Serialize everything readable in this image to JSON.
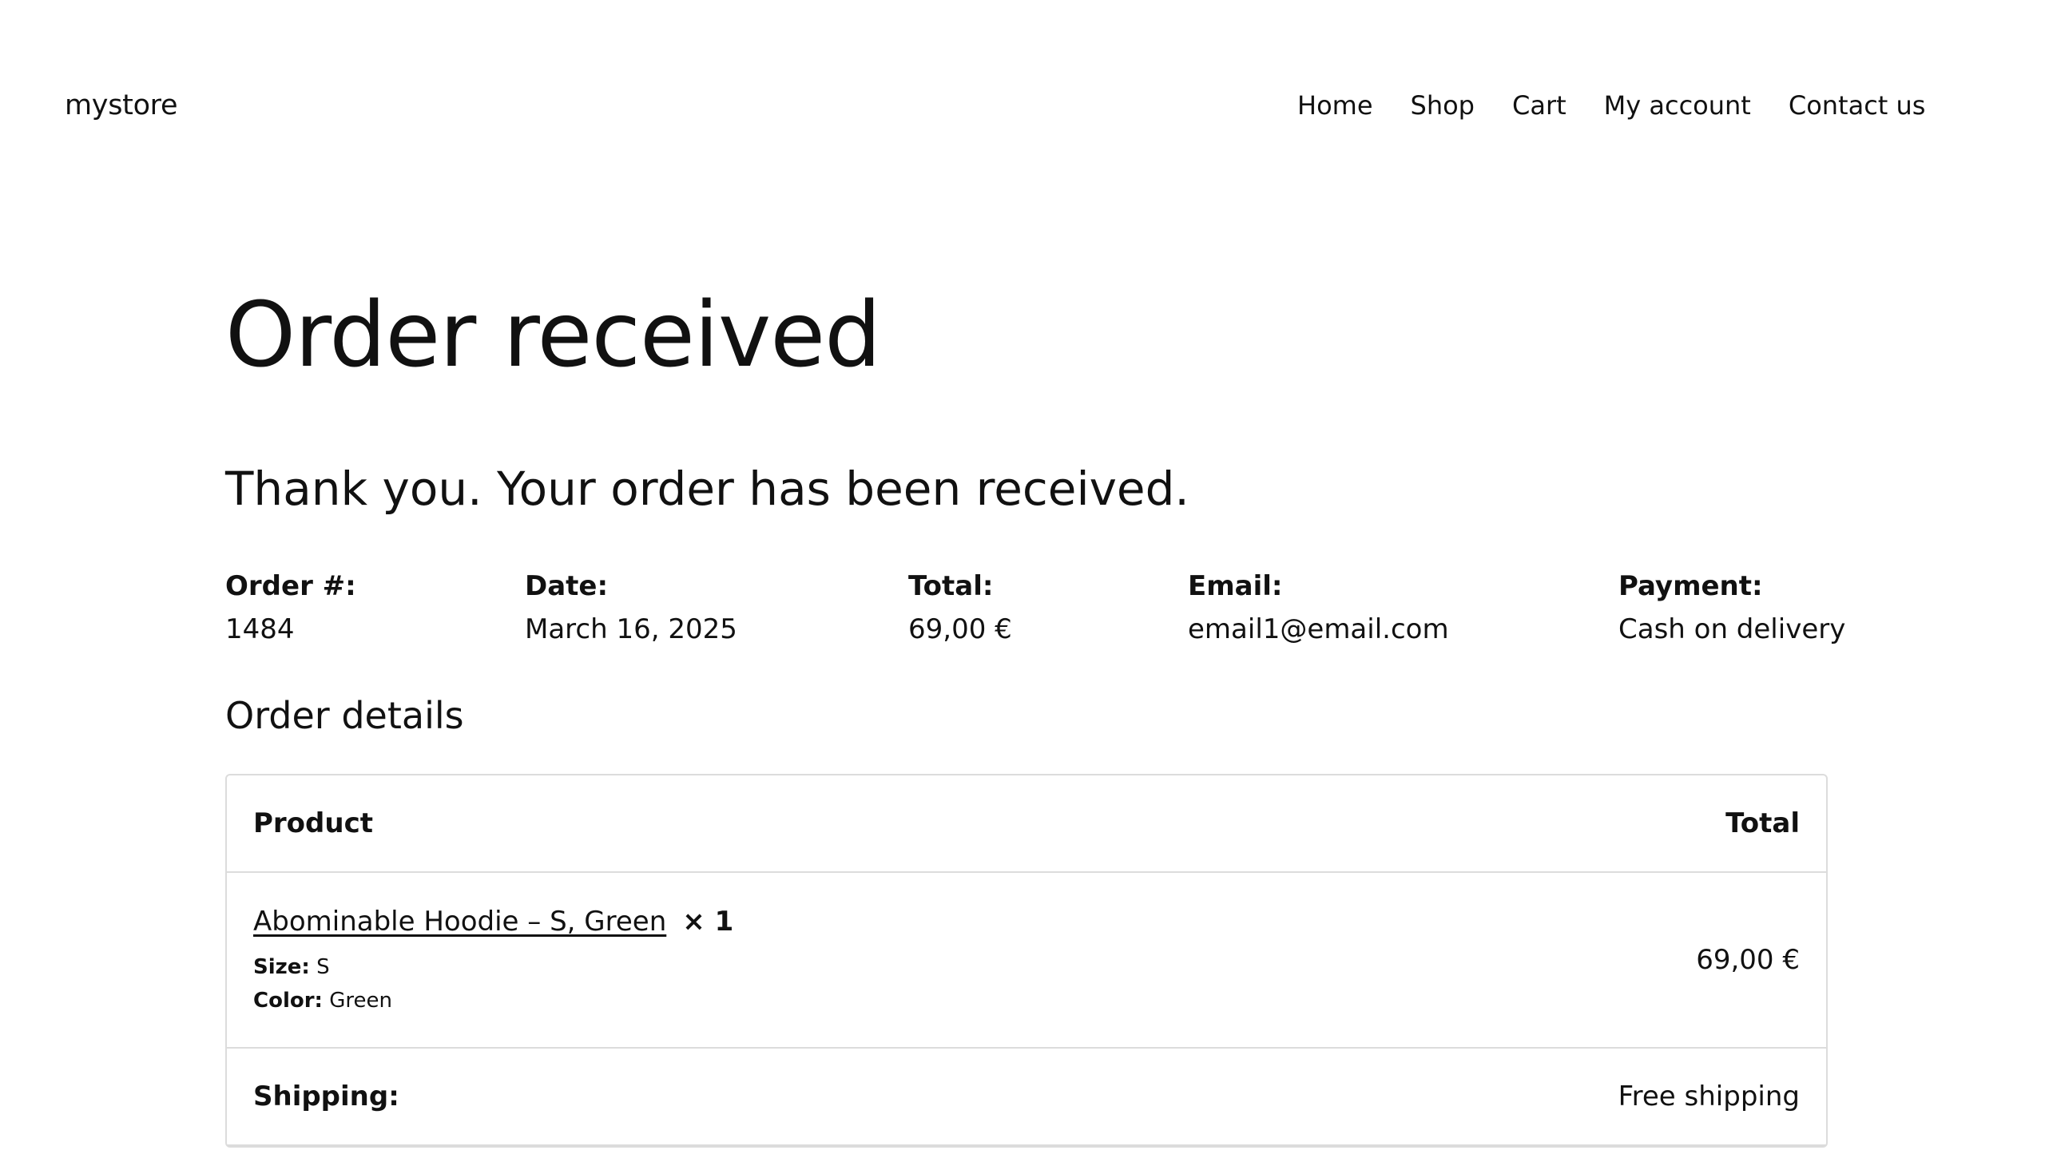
{
  "header": {
    "site_title": "mystore",
    "nav": [
      "Home",
      "Shop",
      "Cart",
      "My account",
      "Contact us"
    ]
  },
  "page": {
    "title": "Order received",
    "thanks": "Thank you. Your order has been received."
  },
  "overview": {
    "order_label": "Order #:",
    "order_value": "1484",
    "date_label": "Date:",
    "date_value": "March 16, 2025",
    "total_label": "Total:",
    "total_value": "69,00 €",
    "email_label": "Email:",
    "email_value": "email1@email.com",
    "payment_label": "Payment:",
    "payment_value": "Cash on delivery"
  },
  "details": {
    "title": "Order details",
    "columns": {
      "product": "Product",
      "total": "Total"
    },
    "item": {
      "name": "Abominable Hoodie – S, Green",
      "quantity": "× 1",
      "size_label": "Size:",
      "size_value": "S",
      "color_label": "Color:",
      "color_value": "Green",
      "total": "69,00 €"
    },
    "shipping": {
      "label": "Shipping:",
      "value": "Free shipping"
    }
  }
}
